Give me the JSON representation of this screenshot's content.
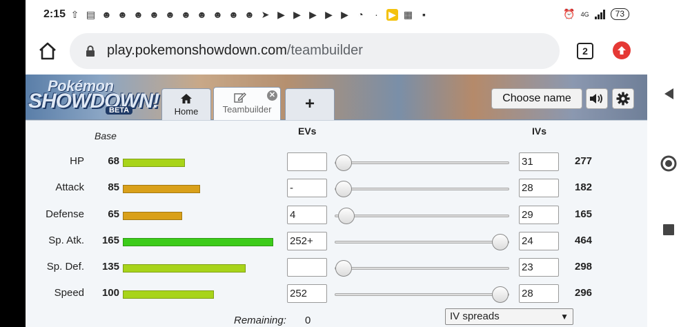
{
  "status_bar": {
    "time": "2:15",
    "battery": "73",
    "network": "4G"
  },
  "browser": {
    "url_host": "play.pokemonshowdown.com",
    "url_path": "/teambuilder",
    "tab_count": "2"
  },
  "header": {
    "logo_top": "Pokémon",
    "logo_main": "SHOWDOWN!",
    "logo_beta": "BETA",
    "tabs": [
      {
        "label": "Home",
        "icon": "home-icon"
      },
      {
        "label": "Teambuilder",
        "icon": "edit-icon"
      },
      {
        "label": "+",
        "icon": "plus-icon"
      }
    ],
    "choose_name": "Choose name"
  },
  "stats": {
    "header_base": "Base",
    "header_evs": "EVs",
    "header_ivs": "IVs",
    "rows": [
      {
        "name": "HP",
        "base": "68",
        "ev": "",
        "ev_fraction": 0.0,
        "iv": "31",
        "total": "277",
        "bar_color": "#a8d41a"
      },
      {
        "name": "Attack",
        "base": "85",
        "ev": "-",
        "ev_fraction": 0.0,
        "iv": "28",
        "total": "182",
        "bar_color": "#d9a01a"
      },
      {
        "name": "Defense",
        "base": "65",
        "ev": "4",
        "ev_fraction": 0.016,
        "iv": "29",
        "total": "165",
        "bar_color": "#d9a01a"
      },
      {
        "name": "Sp. Atk.",
        "base": "165",
        "ev": "252+",
        "ev_fraction": 1.0,
        "iv": "24",
        "total": "464",
        "bar_color": "#3ccc1a"
      },
      {
        "name": "Sp. Def.",
        "base": "135",
        "ev": "",
        "ev_fraction": 0.0,
        "iv": "23",
        "total": "298",
        "bar_color": "#a8d41a"
      },
      {
        "name": "Speed",
        "base": "100",
        "ev": "252",
        "ev_fraction": 1.0,
        "iv": "28",
        "total": "296",
        "bar_color": "#a8d41a"
      }
    ],
    "remaining_label": "Remaining:",
    "remaining_value": "0",
    "iv_spreads": "IV spreads"
  }
}
